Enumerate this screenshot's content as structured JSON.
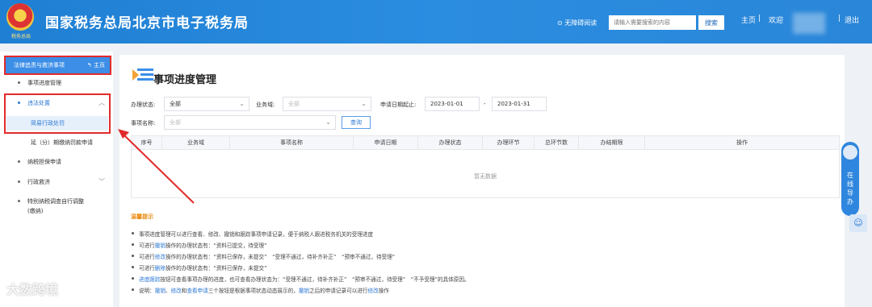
{
  "header": {
    "emblem_text": "税务总局",
    "title": "国家税务总局北京市电子税务局",
    "accessibility": "⊙ 无障碍阅读",
    "search_placeholder": "请输入需要搜索的内容",
    "search_button": "搜索",
    "nav_home": "主页",
    "nav_welcome": "欢迎",
    "nav_exit": "退出"
  },
  "sidebar": {
    "head_label": "法律追责与救济事项",
    "home_label": "↰ 主页",
    "items": [
      {
        "label": "事项进度管理"
      },
      {
        "label": "违法处置"
      },
      {
        "label": "简易行政处罚"
      },
      {
        "label": "延（分）期缴纳罚款申请"
      },
      {
        "label": "纳税担保申请"
      },
      {
        "label": "行政救济"
      },
      {
        "label": "特别纳税调查自行调整",
        "label2": "(缴纳)"
      }
    ]
  },
  "main": {
    "title": "事项进度管理",
    "filters": {
      "status_label": "办理状态:",
      "status_value": "全部",
      "domain_label": "业务域:",
      "domain_value": "全部",
      "date_label": "申请日期起止:",
      "date_start": "2023-01-01",
      "date_sep": "-",
      "date_end": "2023-01-31",
      "name_label": "事项名称:",
      "name_value": "全部",
      "query_button": "查询"
    },
    "columns": [
      "序号",
      "业务域",
      "事项名称",
      "申请日期",
      "办理状态",
      "办理环节",
      "总环节数",
      "办结期限",
      "操作"
    ],
    "empty_text": "暂无数据",
    "tips_title": "温馨提示",
    "tips": [
      {
        "parts": [
          {
            "t": "事项进度管理可以进行查看、修改、撤销和跟踪事项申请记录，便于纳税人跟进税务机关的受理进度"
          }
        ]
      },
      {
        "parts": [
          {
            "t": "可进行"
          },
          {
            "t": "撤销",
            "blue": true
          },
          {
            "t": "操作的办理状态有：“资料已提交，待受理”"
          }
        ]
      },
      {
        "parts": [
          {
            "t": "可进行"
          },
          {
            "t": "修改",
            "blue": true
          },
          {
            "t": "操作的办理状态有：“资料已保存，未提交”　“受理不通过，待补齐补正”　“预审不通过，待受理”"
          }
        ]
      },
      {
        "parts": [
          {
            "t": "可进行"
          },
          {
            "t": "删除",
            "blue": true
          },
          {
            "t": "操作的办理状态有：“资料已保存，未提交”"
          }
        ]
      },
      {
        "parts": [
          {
            "t": "进度跟踪",
            "blue": true
          },
          {
            "t": "按钮可查看事项办理的进度，也可查看办理状态为：“受理不通过，待补齐补正”　“预审不通过，待受理”　“不予受理”的具体原因。"
          }
        ]
      },
      {
        "parts": [
          {
            "t": "说明："
          },
          {
            "t": "撤销",
            "blue": true
          },
          {
            "t": "、"
          },
          {
            "t": "修改",
            "blue": true
          },
          {
            "t": "和"
          },
          {
            "t": "查看申请",
            "blue": true
          },
          {
            "t": "三个按钮是根据事项状态动态展示的，"
          },
          {
            "t": "撤销",
            "blue": true
          },
          {
            "t": "之后的申请记录可以进行"
          },
          {
            "t": "修改",
            "blue": true
          },
          {
            "t": "操作"
          }
        ]
      }
    ]
  },
  "float": {
    "help_text": "在线导办",
    "user_icon": "user-headset-icon"
  },
  "watermark": "大数跨境",
  "colors": {
    "header_blue": "#2b8de0",
    "accent_blue": "#2b78d4",
    "highlight_red": "#e12b2b",
    "tips_orange": "#e8890c"
  }
}
